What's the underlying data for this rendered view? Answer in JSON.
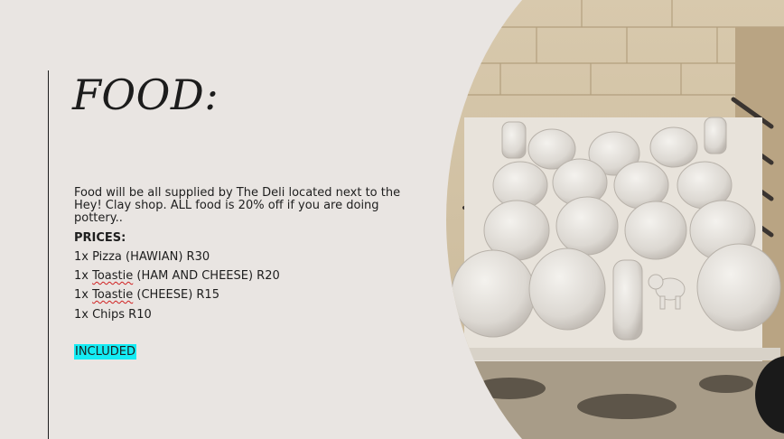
{
  "slide": {
    "title": "FOOD:",
    "description": "Food will be all supplied by The Deli located next to the Hey! Clay shop. ALL food is 20% off if you are doing pottery..",
    "prices_heading": "PRICES:",
    "items": [
      {
        "prefix": "1x Pizza (HAWIAN) R30",
        "flagged": "",
        "suffix": ""
      },
      {
        "prefix": "1x ",
        "flagged": "Toastie",
        "suffix": " (HAM AND CHEESE) R20"
      },
      {
        "prefix": "1x ",
        "flagged": "Toastie",
        "suffix": " (CHEESE) R15"
      },
      {
        "prefix": "1x Chips R10",
        "flagged": "",
        "suffix": ""
      }
    ],
    "included_label": "INCLUDED",
    "photo_subject": "kiln-with-bisque-mugs",
    "highlight_color": "#14ecf4",
    "background_color": "#e9e5e2"
  }
}
